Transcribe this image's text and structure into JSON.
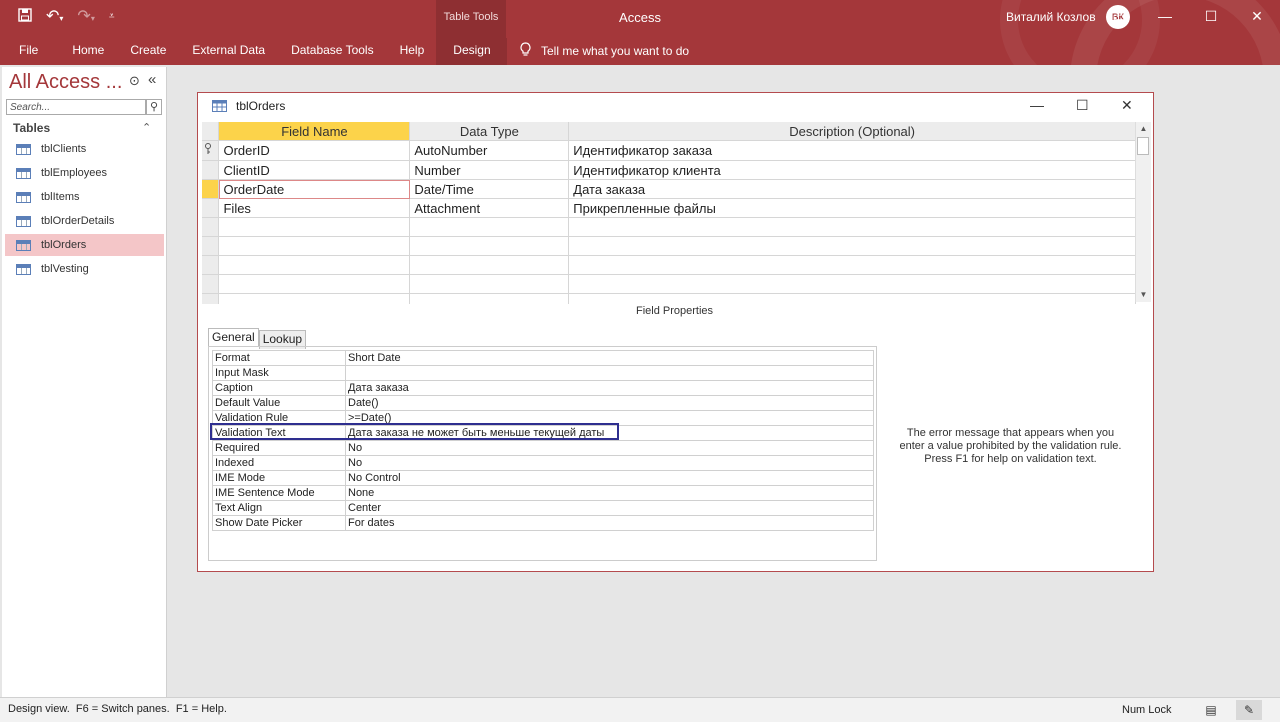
{
  "titlebar": {
    "context_label": "Table Tools",
    "app_title": "Access",
    "user_name": "Виталий Козлов",
    "avatar_text": "ВК"
  },
  "ribbon": {
    "tabs": [
      {
        "label": "File"
      },
      {
        "label": "Home"
      },
      {
        "label": "Create"
      },
      {
        "label": "External Data"
      },
      {
        "label": "Database Tools"
      },
      {
        "label": "Help"
      },
      {
        "label": "Design"
      }
    ],
    "tell_me": "Tell me what you want to do"
  },
  "nav": {
    "title": "All Access ...",
    "search_placeholder": "Search...",
    "group_label": "Tables",
    "items": [
      {
        "label": "tblClients"
      },
      {
        "label": "tblEmployees"
      },
      {
        "label": "tblItems"
      },
      {
        "label": "tblOrderDetails"
      },
      {
        "label": "tblOrders"
      },
      {
        "label": "tblVesting"
      }
    ]
  },
  "document": {
    "title": "tblOrders",
    "columns": {
      "field_name": "Field Name",
      "data_type": "Data Type",
      "description": "Description (Optional)"
    },
    "rows": [
      {
        "field": "OrderID",
        "type": "AutoNumber",
        "desc": "Идентификатор заказа"
      },
      {
        "field": "ClientID",
        "type": "Number",
        "desc": "Идентификатор клиента"
      },
      {
        "field": "OrderDate",
        "type": "Date/Time",
        "desc": "Дата заказа"
      },
      {
        "field": "Files",
        "type": "Attachment",
        "desc": "Прикрепленные файлы"
      }
    ],
    "field_properties_label": "Field Properties",
    "tabs": {
      "general": "General",
      "lookup": "Lookup"
    },
    "properties": [
      {
        "name": "Format",
        "value": "Short Date"
      },
      {
        "name": "Input Mask",
        "value": ""
      },
      {
        "name": "Caption",
        "value": "Дата заказа"
      },
      {
        "name": "Default Value",
        "value": "Date()"
      },
      {
        "name": "Validation Rule",
        "value": ">=Date()"
      },
      {
        "name": "Validation Text",
        "value": "Дата заказа не может быть меньше текущей даты"
      },
      {
        "name": "Required",
        "value": "No"
      },
      {
        "name": "Indexed",
        "value": "No"
      },
      {
        "name": "IME Mode",
        "value": "No Control"
      },
      {
        "name": "IME Sentence Mode",
        "value": "None"
      },
      {
        "name": "Text Align",
        "value": "Center"
      },
      {
        "name": "Show Date Picker",
        "value": "For dates"
      }
    ],
    "help_line1": "The error message that appears when you",
    "help_line2": "enter a value prohibited by the validation rule.",
    "help_line3": "Press F1 for help on validation text."
  },
  "status": {
    "left": "Design view.  F6 = Switch panes.  F1 = Help.",
    "numlock": "Num Lock"
  },
  "colors": {
    "accent": "#a4373a",
    "selected_nav": "#f4c6c8",
    "header_highlight": "#fcd34a",
    "validation_box": "#2e2e8f"
  }
}
